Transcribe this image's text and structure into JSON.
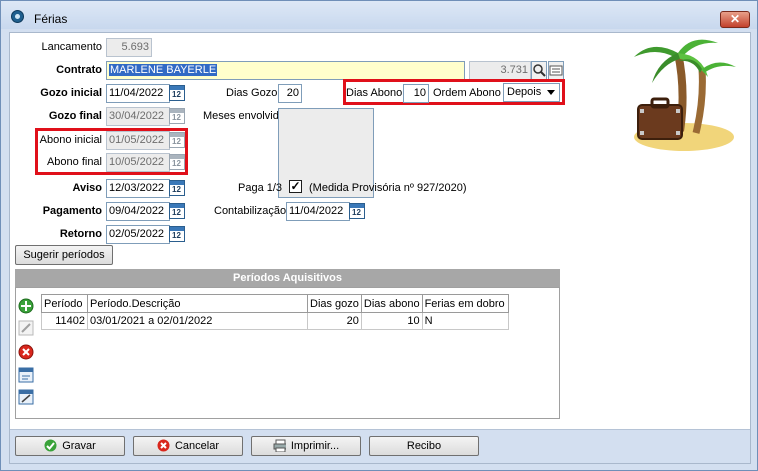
{
  "window": {
    "title": "Férias",
    "close_label": "✕"
  },
  "form": {
    "lancamento": {
      "label": "Lancamento",
      "value": "5.693"
    },
    "contrato": {
      "label": "Contrato",
      "value": "MARLENE BAYERLE",
      "code": "3.731"
    },
    "gozo_inicial": {
      "label": "Gozo inicial",
      "value": "11/04/2022"
    },
    "dias_gozo": {
      "label": "Dias Gozo",
      "value": "20"
    },
    "dias_abono": {
      "label": "Dias Abono",
      "value": "10"
    },
    "ordem_abono": {
      "label": "Ordem Abono",
      "value": "Depois"
    },
    "gozo_final": {
      "label": "Gozo final",
      "value": "30/04/2022"
    },
    "meses_envolvidos": {
      "label": "Meses envolvidos"
    },
    "abono_inicial": {
      "label": "Abono inicial",
      "value": "01/05/2022"
    },
    "abono_final": {
      "label": "Abono final",
      "value": "10/05/2022"
    },
    "aviso": {
      "label": "Aviso",
      "value": "12/03/2022"
    },
    "paga": {
      "label": "Paga 1/3",
      "checked": true,
      "note": "(Medida Provisória nº 927/2020)"
    },
    "pagamento": {
      "label": "Pagamento",
      "value": "09/04/2022"
    },
    "contabilizacao": {
      "label": "Contabilização",
      "value": "11/04/2022"
    },
    "retorno": {
      "label": "Retorno",
      "value": "02/05/2022"
    },
    "sugerir_label": "Sugerir períodos"
  },
  "periodos": {
    "title": "Períodos Aquisitivos",
    "columns": [
      "Período",
      "Período.Descrição",
      "Dias gozo",
      "Dias abono",
      "Ferias em dobro"
    ],
    "rows": [
      {
        "periodo": "11402",
        "descricao": "03/01/2021 a 02/01/2022",
        "dias_gozo": "20",
        "dias_abono": "10",
        "dobro": "N"
      }
    ]
  },
  "buttons": {
    "gravar": "Gravar",
    "cancelar": "Cancelar",
    "imprimir": "Imprimir...",
    "recibo": "Recibo"
  },
  "icons": {
    "calendar": "calendar-icon",
    "add": "add-icon",
    "edit": "edit-icon",
    "delete": "delete-icon",
    "view": "view-icon",
    "edit2": "edit-row-icon",
    "illustration": "vacation-island-icon"
  },
  "colors": {
    "highlight": "#e0101a",
    "selection": "#316ac5",
    "contract_field": "#ffffcc"
  }
}
